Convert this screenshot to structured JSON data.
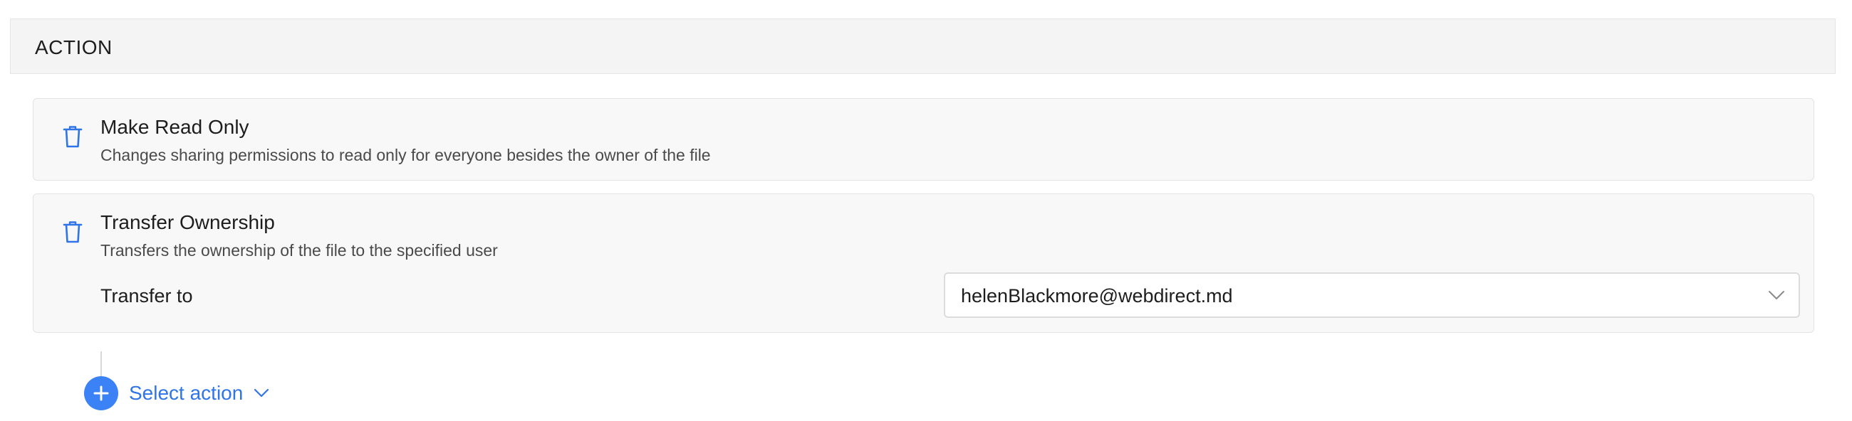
{
  "section": {
    "title": "ACTION"
  },
  "actions": [
    {
      "title": "Make Read Only",
      "description": "Changes sharing permissions to read only for everyone besides the owner of the file",
      "icon": "trash-icon"
    },
    {
      "title": "Transfer Ownership",
      "description": "Transfers the ownership of the file to the specified user",
      "icon": "trash-icon",
      "field": {
        "label": "Transfer to",
        "value": "helenBlackmore@webdirect.md",
        "icon": "chevron-down-icon"
      }
    }
  ],
  "add_action": {
    "label": "Select action",
    "icon": "plus-icon",
    "dropdown_icon": "chevron-down-icon"
  },
  "colors": {
    "accent": "#3b82f6",
    "link": "#2f74e8",
    "header_bg": "#f4f4f4",
    "card_bg": "#f8f8f8"
  }
}
